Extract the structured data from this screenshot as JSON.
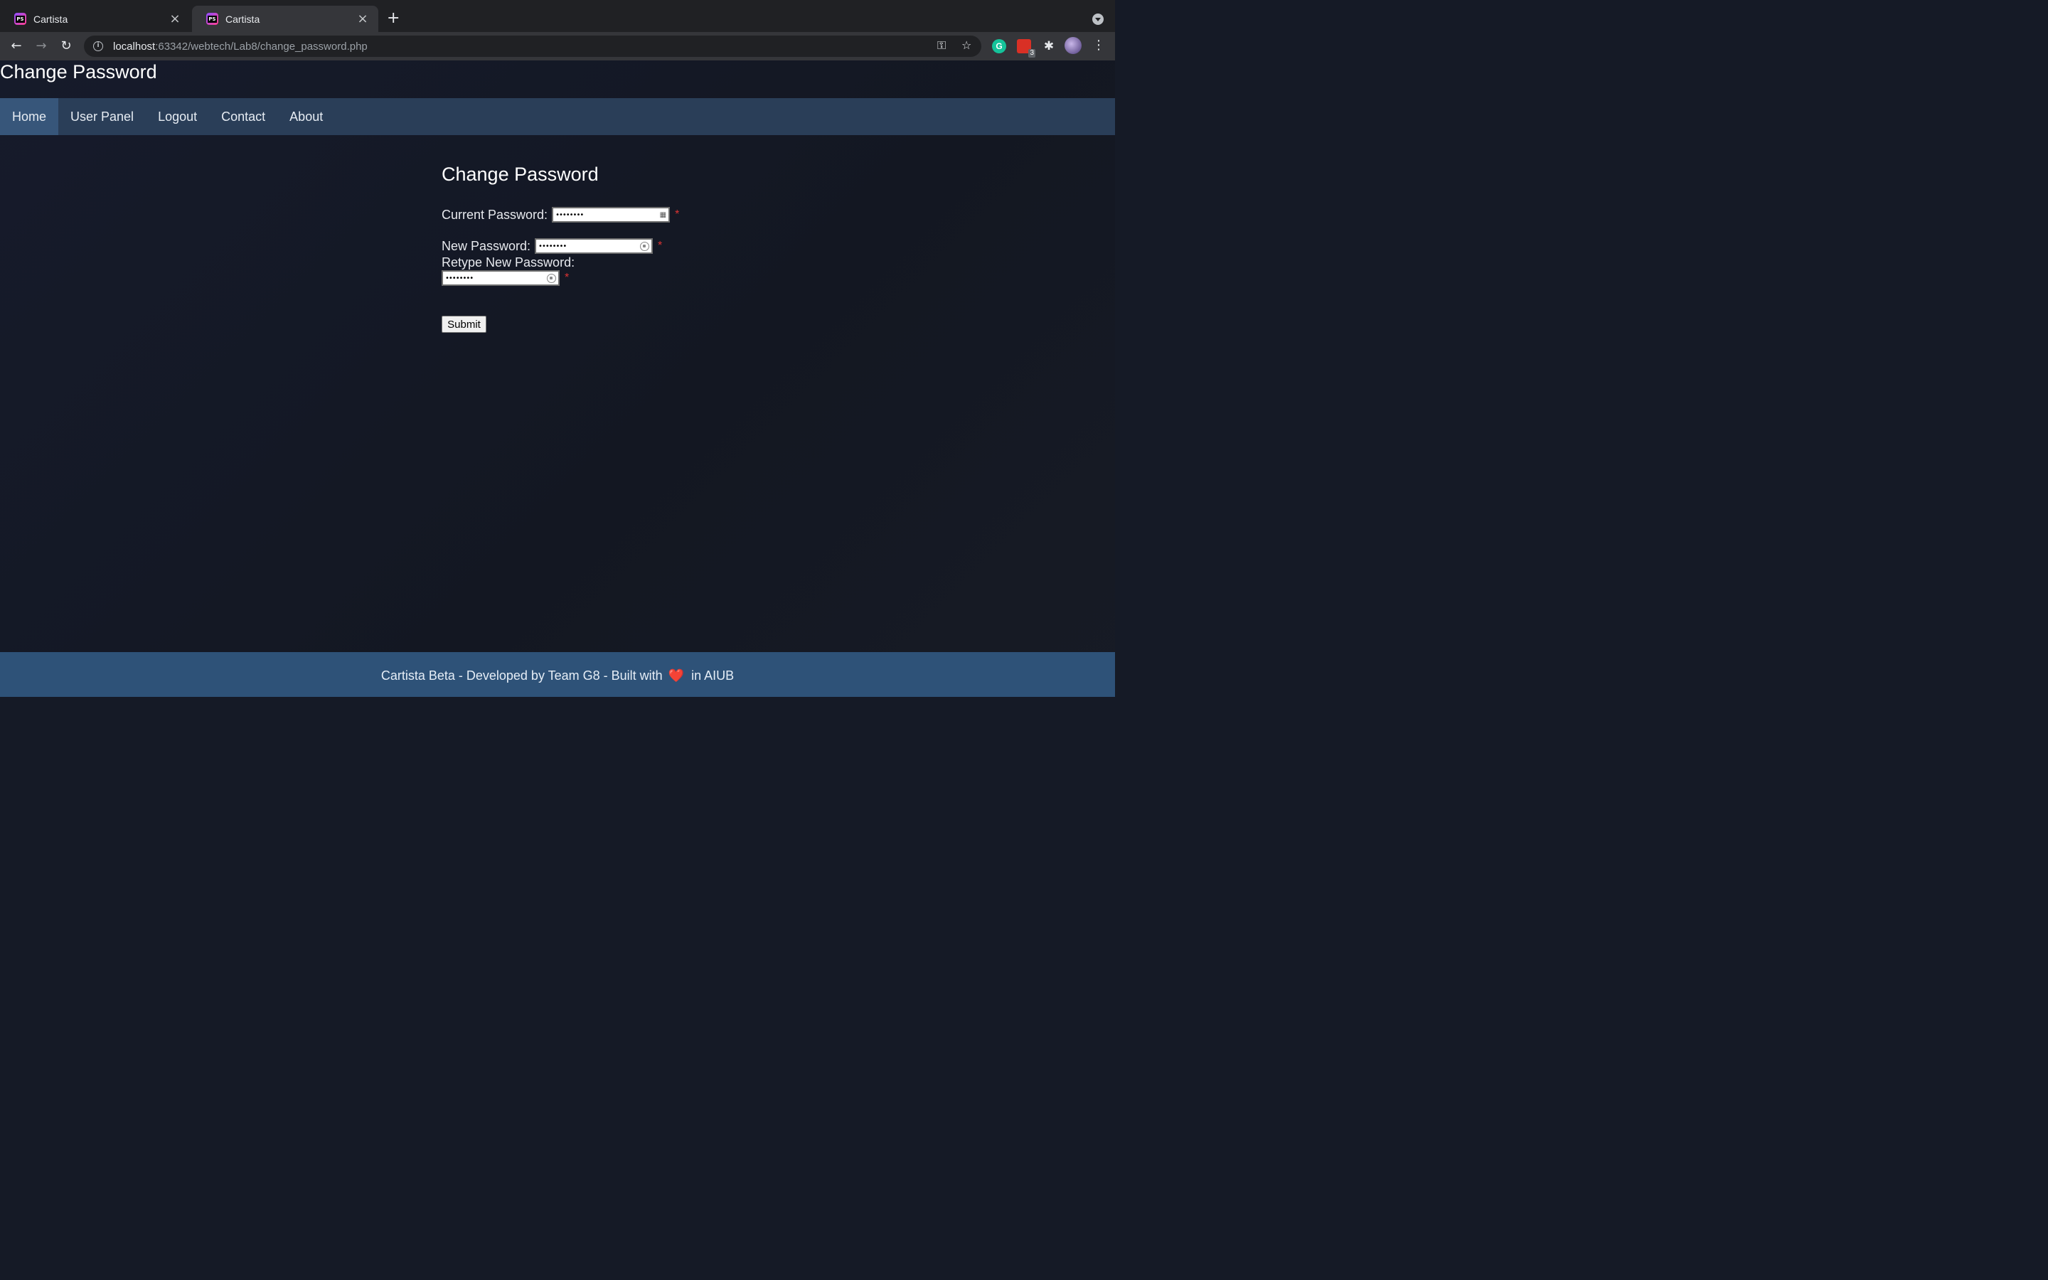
{
  "browser": {
    "tabs": [
      {
        "title": "Cartista",
        "favicon": "PS"
      },
      {
        "title": "Cartista",
        "favicon": "PS"
      }
    ],
    "url_host": "localhost",
    "url_rest": ":63342/webtech/Lab8/change_password.php",
    "ext_badge": "3"
  },
  "site": {
    "title": "Change Password",
    "nav": [
      "Home",
      "User Panel",
      "Logout",
      "Contact",
      "About"
    ]
  },
  "form": {
    "title": "Change Password",
    "current_label": "Current Password:",
    "new_label": "New Password:",
    "retype_label": "Retype New Password:",
    "current_value": "••••••••",
    "new_value": "••••••••",
    "retype_value": "••••••••",
    "required_mark": "*",
    "submit_label": "Submit"
  },
  "footer": {
    "text_before": "Cartista Beta - Developed by Team G8 - Built with",
    "heart": "❤️",
    "text_after": "in AIUB"
  },
  "colors": {
    "nav_bg": "#2a3e58",
    "nav_active": "#37567a",
    "footer_bg": "#2e5278",
    "required": "#dd3333"
  }
}
